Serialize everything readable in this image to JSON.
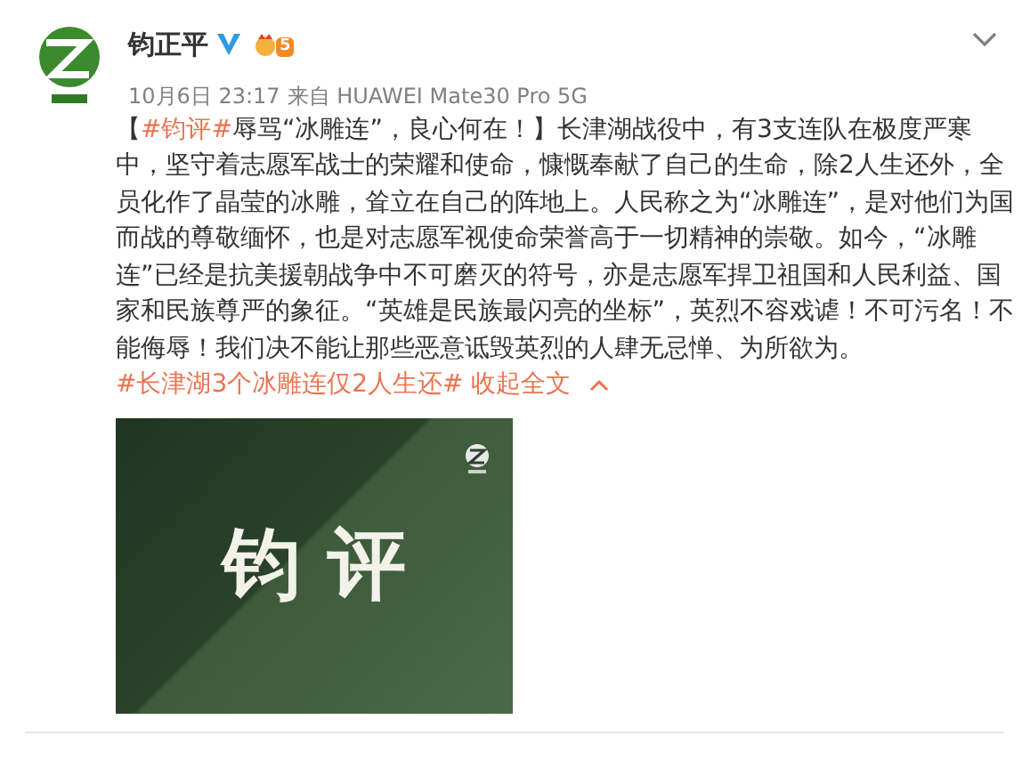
{
  "author": {
    "name": "钧正平",
    "verified": true,
    "member_level": "5"
  },
  "meta": {
    "date": "10月6日 23:17",
    "source": "来自 HUAWEI Mate30 Pro 5G"
  },
  "body": [
    {
      "kind": "text",
      "text": "【"
    },
    {
      "kind": "topic",
      "text": "#钧评#"
    },
    {
      "kind": "text",
      "text": "辱骂“冰雕连”，良心何在！】长津湖战役中，有3支连队在极度严寒中，坚守着志愿军战士的荣耀和使命，慷慨奉献了自己的生命，除2人生还外，全员化作了晶莹的冰雕，耸立在自己的阵地上。人民称之为“冰雕连”，是对他们为国而战的尊敬缅怀，也是对志愿军视使命荣誉高于一切精神的崇敬。如今，“冰雕连”已经是抗美援朝战争中不可磨灭的符号，亦是志愿军捍卫祖国和人民利益、国家和民族尊严的象征。“英雄是民族最闪亮的坐标”，英烈不容戏谑！不可污名！不能侮辱！我们决不能让那些恶意诋毁英烈的人肆无忌惮、为所欲为。"
    },
    {
      "kind": "topic",
      "text": "#长津湖3个冰雕连仅2人生还#"
    }
  ],
  "collapse": {
    "label": "收起全文"
  },
  "image": {
    "title": "钧 评"
  }
}
